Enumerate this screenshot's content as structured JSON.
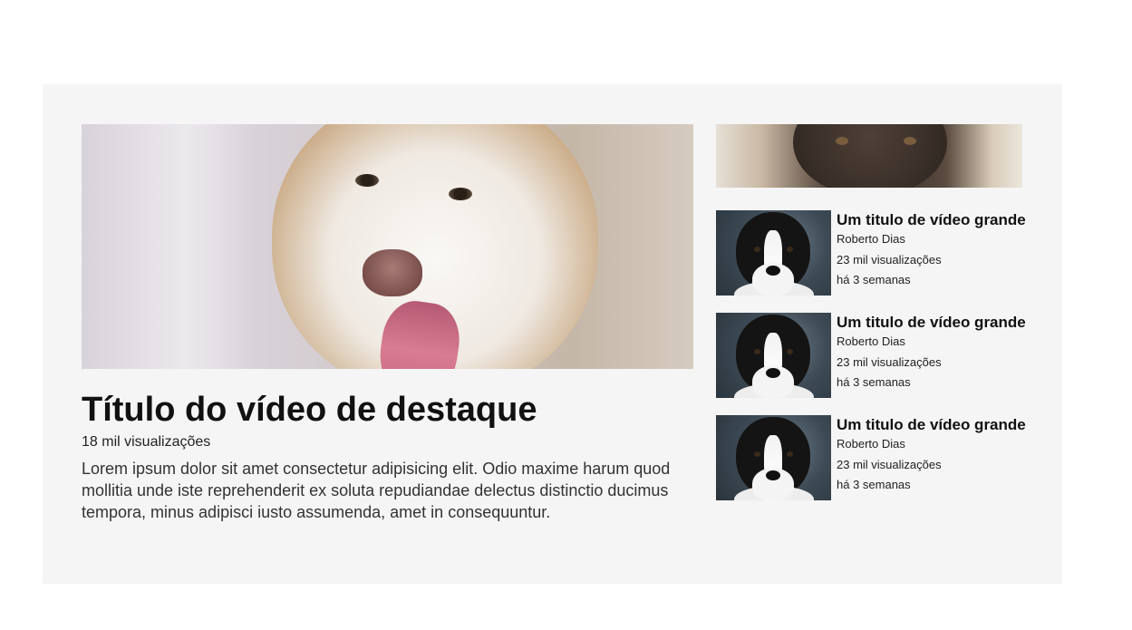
{
  "featured": {
    "title": "Título do vídeo de destaque",
    "views": "18 mil visualizações",
    "description": "Lorem ipsum dolor sit amet consectetur adipisicing elit. Odio maxime harum quod mollitia unde iste reprehenderit ex soluta repudiandae delectus distinctio ducimus tempora, minus adipisci iusto assumenda, amet in consequuntur."
  },
  "related": [
    {
      "title": "Um titulo de vídeo grande",
      "author": "Roberto Dias",
      "views": "23 mil visualizações",
      "date": "há 3 semanas"
    },
    {
      "title": "Um titulo de vídeo grande",
      "author": "Roberto Dias",
      "views": "23 mil visualizações",
      "date": "há 3 semanas"
    },
    {
      "title": "Um titulo de vídeo grande",
      "author": "Roberto Dias",
      "views": "23 mil visualizações",
      "date": "há 3 semanas"
    }
  ],
  "colors": {
    "panel_bg": "#f5f5f5",
    "page_bg": "#ffffff",
    "text": "#111111"
  }
}
